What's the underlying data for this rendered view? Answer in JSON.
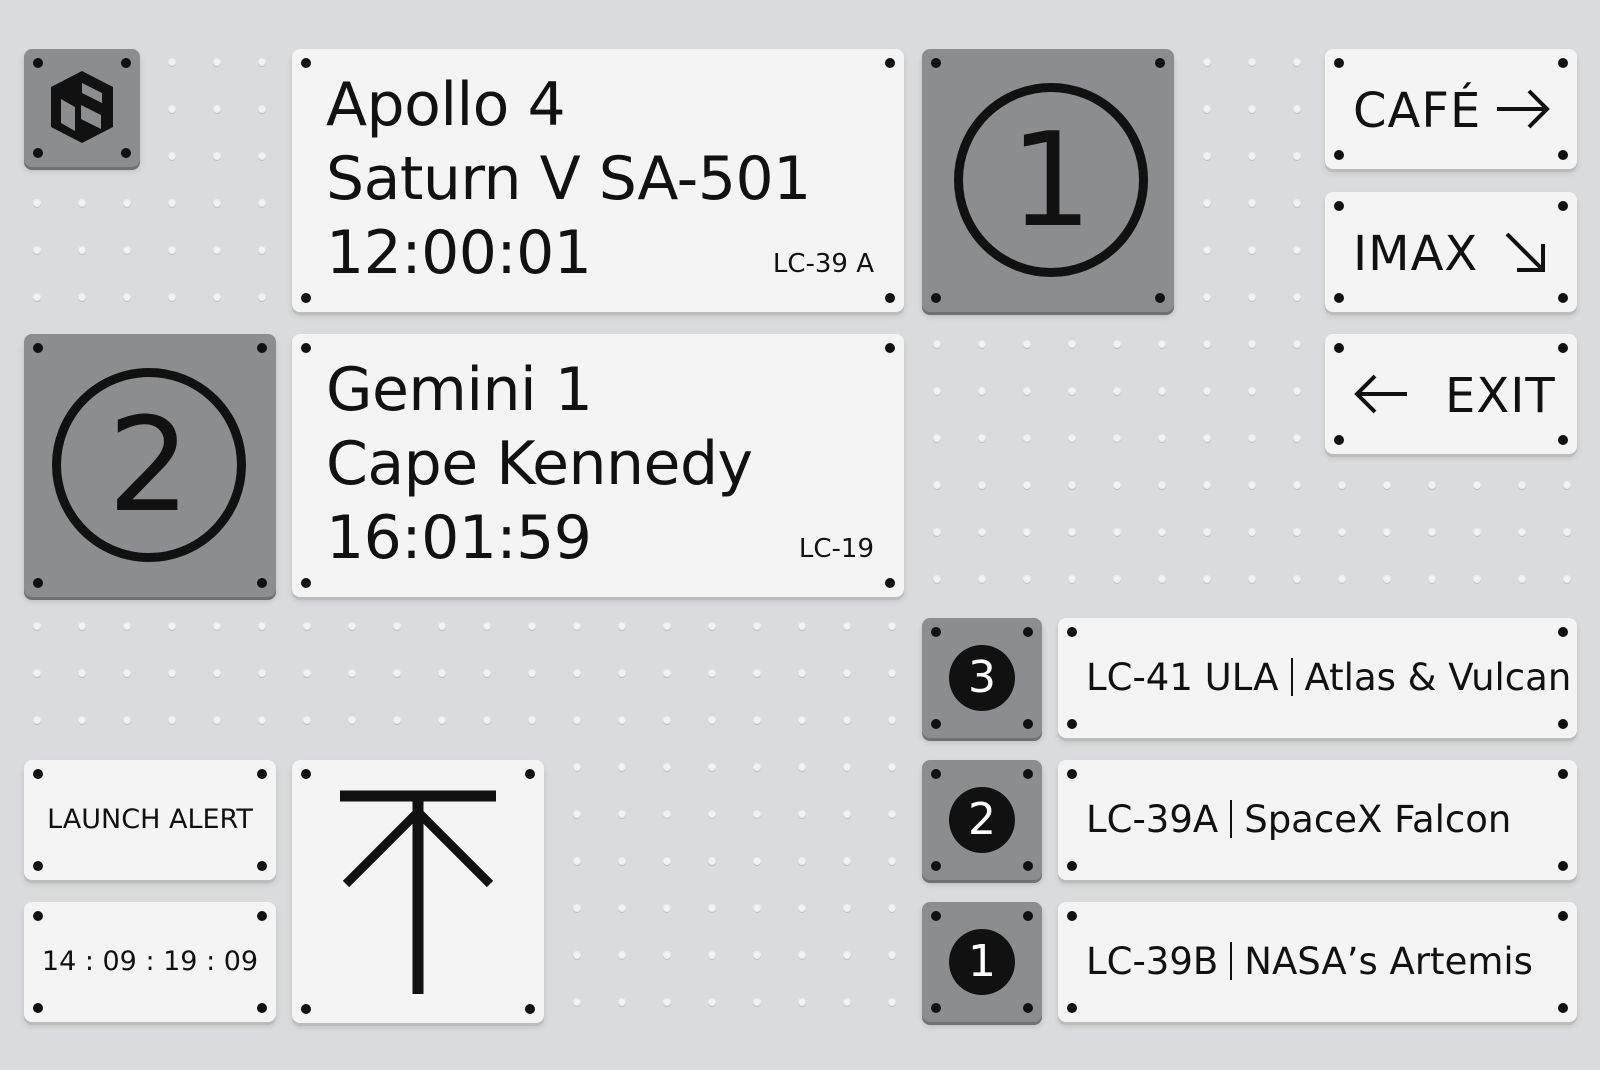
{
  "launch_pad_1": {
    "mission": "Apollo 4",
    "vehicle": "Saturn V SA-501",
    "time": "12:00:01",
    "pad": "LC-39 A",
    "number": "1"
  },
  "launch_pad_2": {
    "mission": "Gemini 1",
    "vehicle": "Cape Kennedy",
    "time": "16:01:59",
    "pad": "LC-19",
    "number": "2"
  },
  "nav": {
    "cafe": "CAFÉ",
    "imax": "IMAX",
    "exit": "EXIT"
  },
  "pads": [
    {
      "num": "3",
      "code": "LC-41 ULA",
      "name": "Atlas & Vulcan"
    },
    {
      "num": "2",
      "code": "LC-39A",
      "name": "SpaceX Falcon"
    },
    {
      "num": "1",
      "code": "LC-39B",
      "name": "NASA’s Artemis"
    }
  ],
  "alert": {
    "label": "LAUNCH ALERT",
    "countdown": "14 : 09 : 19 : 09"
  },
  "icons": {
    "logo": "kennedy-logo-icon",
    "up": "arrow-up-to-bar-icon",
    "right": "arrow-right-icon",
    "down_right": "arrow-down-right-icon",
    "left": "arrow-left-icon"
  },
  "colors": {
    "background": "#dadbdc",
    "panel_light": "#f4f4f4",
    "panel_dark": "#8b8d8e",
    "ink": "#111111"
  }
}
